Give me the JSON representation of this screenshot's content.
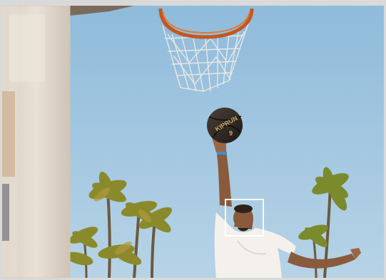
{
  "photo": {
    "ball_brand": "KIPRUN",
    "ball_number": "9",
    "detection_box_color": "#ffffff",
    "sky_color": "#9cc3de",
    "rim_color": "#c4571f"
  }
}
